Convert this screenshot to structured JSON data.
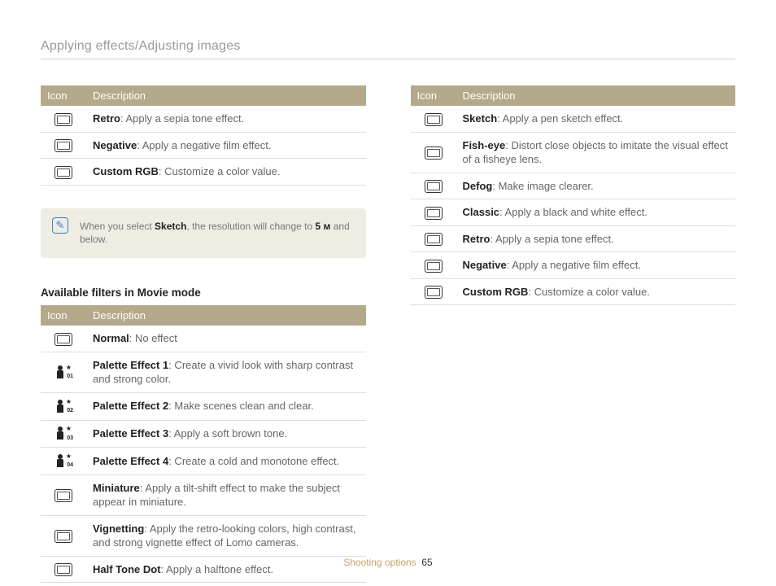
{
  "page_title": "Applying effects/Adjusting images",
  "th_icon": "Icon",
  "th_desc": "Description",
  "left_table1": [
    {
      "icon": "retro-icon",
      "term": "Retro",
      "desc": ": Apply a sepia tone effect."
    },
    {
      "icon": "negative-icon",
      "term": "Negative",
      "desc": ": Apply a negative film effect."
    },
    {
      "icon": "custom-rgb-icon",
      "term": "Custom RGB",
      "desc": ": Customize a color value."
    }
  ],
  "note": {
    "pre": "When you select ",
    "bold1": "Sketch",
    "mid": ", the resolution will change to ",
    "bold2": "5 м",
    "post": " and below."
  },
  "movie_heading": "Available filters in Movie mode",
  "left_table2": [
    {
      "icon": "normal-icon",
      "kind": "box",
      "term": "Normal",
      "desc": ": No effect"
    },
    {
      "icon": "palette1-icon",
      "kind": "person",
      "sub": "01",
      "term": "Palette Effect 1",
      "desc": ": Create a vivid look with sharp contrast and strong color."
    },
    {
      "icon": "palette2-icon",
      "kind": "person",
      "sub": "02",
      "term": "Palette Effect 2",
      "desc": ": Make scenes clean and clear."
    },
    {
      "icon": "palette3-icon",
      "kind": "person",
      "sub": "03",
      "term": "Palette Effect 3",
      "desc": ": Apply a soft brown tone."
    },
    {
      "icon": "palette4-icon",
      "kind": "person",
      "sub": "04",
      "term": "Palette Effect 4",
      "desc": ": Create a cold and monotone effect."
    },
    {
      "icon": "miniature-icon",
      "kind": "box",
      "term": "Miniature",
      "desc": ": Apply a tilt-shift effect to make the subject appear in miniature."
    },
    {
      "icon": "vignetting-icon",
      "kind": "box",
      "term": "Vignetting",
      "desc": ": Apply the retro-looking colors, high contrast, and strong vignette effect of Lomo cameras."
    },
    {
      "icon": "halftone-icon",
      "kind": "box",
      "term": "Half Tone Dot",
      "desc": ": Apply a halftone effect."
    }
  ],
  "right_table": [
    {
      "icon": "sketch-icon",
      "term": "Sketch",
      "desc": ": Apply a pen sketch effect."
    },
    {
      "icon": "fisheye-icon",
      "term": "Fish-eye",
      "desc": ": Distort close objects to imitate the visual effect of a fisheye lens."
    },
    {
      "icon": "defog-icon",
      "term": "Defog",
      "desc": ": Make image clearer."
    },
    {
      "icon": "classic-icon",
      "term": "Classic",
      "desc": ": Apply a black and white effect."
    },
    {
      "icon": "retro-icon",
      "term": "Retro",
      "desc": ": Apply a sepia tone effect."
    },
    {
      "icon": "negative-icon",
      "term": "Negative",
      "desc": ": Apply a negative film effect."
    },
    {
      "icon": "custom-rgb-icon",
      "term": "Custom RGB",
      "desc": ": Customize a color value."
    }
  ],
  "footer_section": "Shooting options",
  "footer_page": "65"
}
